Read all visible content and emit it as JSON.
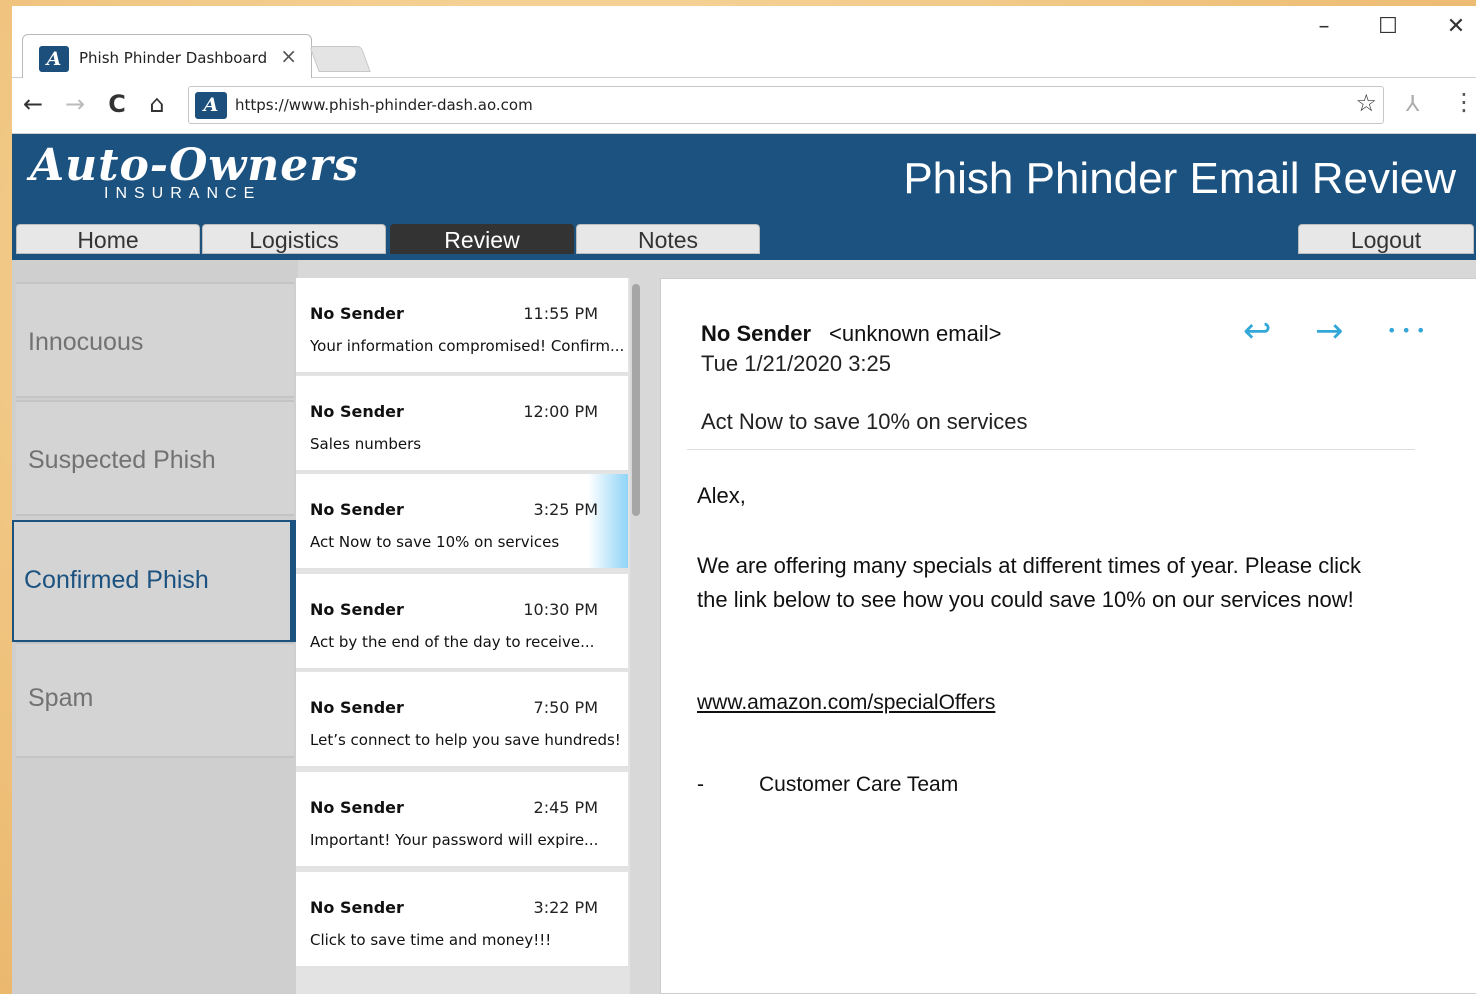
{
  "browser": {
    "tab_title": "Phish Phinder Dashboard",
    "tab_close": "×",
    "favicon": "A",
    "url": "https://www.phish-phinder-dash.ao.com",
    "controls": {
      "minimize": "–",
      "maximize": "☐",
      "close": "✕"
    },
    "nav": {
      "back": "←",
      "forward": "→",
      "reload": "C",
      "home": "⌂"
    },
    "bookmark": "☆",
    "extension": "⅄",
    "menu": "⋮"
  },
  "brand": {
    "logo_main": "Auto-Owners",
    "logo_sub": "INSURANCE"
  },
  "app_title": "Phish Phinder Email Review",
  "nav_tabs": [
    {
      "label": "Home"
    },
    {
      "label": "Logistics"
    },
    {
      "label": "Review"
    },
    {
      "label": "Notes"
    }
  ],
  "logout_label": "Logout",
  "categories": [
    {
      "label": "Innocuous"
    },
    {
      "label": "Suspected Phish"
    },
    {
      "label": "Confirmed Phish"
    },
    {
      "label": "Spam"
    }
  ],
  "emails": [
    {
      "sender": "No Sender",
      "time": "11:55 PM",
      "subject": "Your information compromised! Confirm..."
    },
    {
      "sender": "No Sender",
      "time": "12:00 PM",
      "subject": "Sales numbers"
    },
    {
      "sender": "No Sender",
      "time": "3:25 PM",
      "subject": "Act Now to save 10% on services"
    },
    {
      "sender": "No Sender",
      "time": "10:30 PM",
      "subject": "Act by the end of the day to receive..."
    },
    {
      "sender": "No Sender",
      "time": "7:50 PM",
      "subject": "Let’s connect to help you save hundreds!"
    },
    {
      "sender": "No Sender",
      "time": "2:45 PM",
      "subject": "Important! Your password will expire..."
    },
    {
      "sender": "No Sender",
      "time": "3:22 PM",
      "subject": "Click to save time and money!!!"
    }
  ],
  "reading": {
    "sender": "No Sender",
    "email": "<unknown email>",
    "date": "Tue 1/21/2020 3:25",
    "subject": "Act Now to save 10% on services",
    "greeting": "Alex,",
    "body": "We are offering many specials at different times of year. Please click the link below to see how you could save 10% on our services now!",
    "link": "www.amazon.com/specialOffers",
    "signature_dash": "-",
    "signature": "Customer Care Team",
    "actions": {
      "reply": "↩",
      "forward": "→",
      "more": "• • •"
    }
  },
  "colors": {
    "brand_blue": "#1c5280",
    "accent_cyan": "#34a7d9"
  }
}
